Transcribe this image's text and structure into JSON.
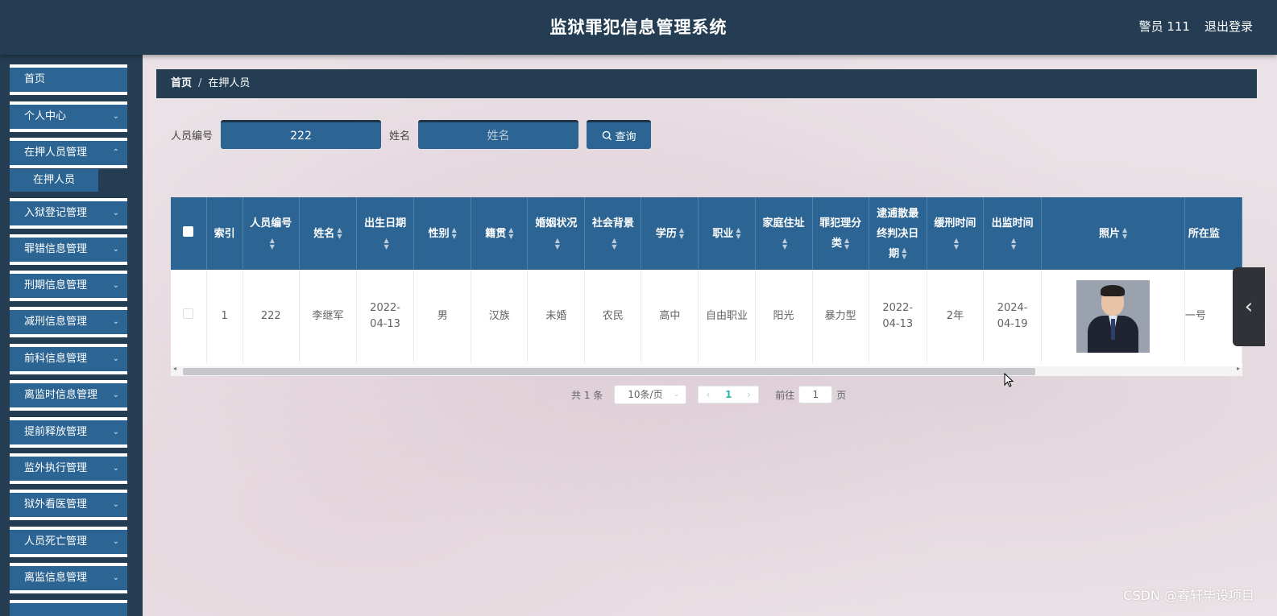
{
  "header": {
    "title": "监狱罪犯信息管理系统",
    "user": "警员 111",
    "logout": "退出登录"
  },
  "sidebar": {
    "items": [
      {
        "label": "首页",
        "has_chevron": false
      },
      {
        "label": "个人中心",
        "has_chevron": true
      },
      {
        "label": "在押人员管理",
        "has_chevron": true
      },
      {
        "label": "入狱登记管理",
        "has_chevron": true
      },
      {
        "label": "罪错信息管理",
        "has_chevron": true
      },
      {
        "label": "刑期信息管理",
        "has_chevron": true
      },
      {
        "label": "减刑信息管理",
        "has_chevron": true
      },
      {
        "label": "前科信息管理",
        "has_chevron": true
      },
      {
        "label": "离监时信息管理",
        "has_chevron": true
      },
      {
        "label": "提前释放管理",
        "has_chevron": true
      },
      {
        "label": "监外执行管理",
        "has_chevron": true
      },
      {
        "label": "狱外看医管理",
        "has_chevron": true
      },
      {
        "label": "人员死亡管理",
        "has_chevron": true
      },
      {
        "label": "离监信息管理",
        "has_chevron": true
      }
    ],
    "subitem": "在押人员"
  },
  "breadcrumb": {
    "home": "首页",
    "separator": "/",
    "current": "在押人员"
  },
  "search": {
    "id_label": "人员编号",
    "id_value": "222",
    "name_label": "姓名",
    "name_placeholder": "姓名",
    "button": "查询"
  },
  "table": {
    "columns": [
      "",
      "索引",
      "人员编号",
      "姓名",
      "出生日期",
      "性别",
      "籍贯",
      "婚姻状况",
      "社会背景",
      "学历",
      "职业",
      "家庭住址",
      "罪犯理分类",
      "逮逋散最终判决日期",
      "缓刑时间",
      "出监时间",
      "照片",
      "所在监"
    ],
    "rows": [
      [
        "",
        "1",
        "222",
        "李继军",
        "2022-04-13",
        "男",
        "汉族",
        "未婚",
        "农民",
        "高中",
        "自由职业",
        "阳光",
        "暴力型",
        "2022-04-13",
        "2年",
        "2024-04-19",
        "",
        "一号"
      ]
    ]
  },
  "pagination": {
    "total": "共 1 条",
    "page_size": "10条/页",
    "current_page": "1",
    "goto_label": "前往",
    "goto_value": "1",
    "page_suffix": "页"
  },
  "watermark": "CSDN @睿轩毕设项目"
}
